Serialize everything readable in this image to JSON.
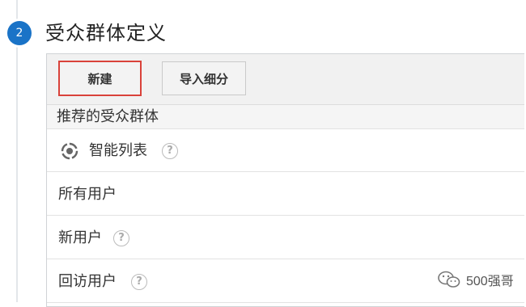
{
  "step": {
    "number": "2",
    "title": "受众群体定义"
  },
  "toolbar": {
    "new_label": "新建",
    "import_label": "导入细分"
  },
  "group": {
    "header": "推荐的受众群体"
  },
  "items": [
    {
      "label": "智能列表",
      "icon": "smart-list-icon",
      "has_help": true
    },
    {
      "label": "所有用户",
      "has_help": false
    },
    {
      "label": "新用户",
      "has_help": true
    },
    {
      "label": "回访用户",
      "has_help": true
    }
  ],
  "help_glyph": "?",
  "watermark": {
    "text": "500强哥",
    "icon": "wechat-icon"
  },
  "colors": {
    "accent": "#1a73c7",
    "highlight_border": "#d9423a"
  }
}
